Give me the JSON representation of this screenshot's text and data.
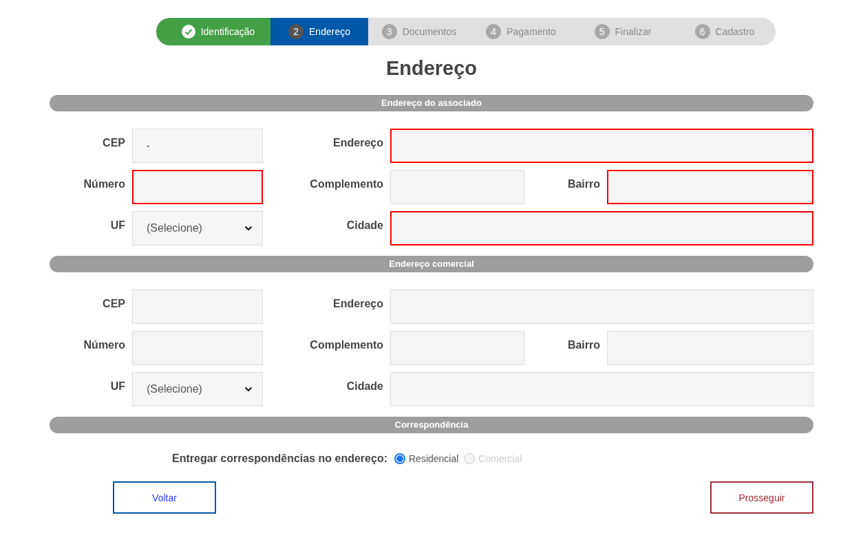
{
  "steps": [
    {
      "label": "Identificação",
      "done": true,
      "selected": false
    },
    {
      "number": "2",
      "label": "Endereço",
      "done": false,
      "selected": true
    },
    {
      "number": "3",
      "label": "Documentos",
      "done": false,
      "selected": false
    },
    {
      "number": "4",
      "label": "Pagamento",
      "done": false,
      "selected": false
    },
    {
      "number": "5",
      "label": "Finalizar",
      "done": false,
      "selected": false
    },
    {
      "number": "6",
      "label": "Cadastro",
      "done": false,
      "selected": false
    }
  ],
  "title": "Endereço",
  "sections": [
    {
      "title": "Endereço do associado",
      "rows": [
        [
          {
            "label": "CEP",
            "kind": "input",
            "value": "-",
            "invalid": false
          },
          {
            "label": "Endereço",
            "kind": "input",
            "invalid": true
          }
        ],
        [
          {
            "label": "Número",
            "kind": "input",
            "invalid": true
          },
          {
            "label": "Complemento",
            "kind": "input",
            "invalid": false
          },
          {
            "label": "Bairro",
            "kind": "input",
            "invalid": true
          }
        ],
        [
          {
            "label": "UF",
            "kind": "select",
            "value": "(Selecione)",
            "invalid": false
          },
          {
            "label": "Cidade",
            "kind": "input",
            "invalid": true
          }
        ]
      ]
    },
    {
      "title": "Endereço comercial",
      "rows": [
        [
          {
            "label": "CEP",
            "kind": "input",
            "invalid": false
          },
          {
            "label": "Endereço",
            "kind": "input",
            "invalid": false
          }
        ],
        [
          {
            "label": "Número",
            "kind": "input",
            "invalid": false
          },
          {
            "label": "Complemento",
            "kind": "input",
            "invalid": false
          },
          {
            "label": "Bairro",
            "kind": "input",
            "invalid": false
          }
        ],
        [
          {
            "label": "UF",
            "kind": "select",
            "value": "(Selecione)",
            "invalid": false
          },
          {
            "label": "Cidade",
            "kind": "input",
            "invalid": false
          }
        ]
      ]
    }
  ],
  "correspondence": {
    "title": "Correspondência",
    "question": "Entregar correspondências no endereço:",
    "options": [
      {
        "label": "Residencial",
        "selected": true,
        "disabled": false
      },
      {
        "label": "Comercial",
        "selected": false,
        "disabled": true
      }
    ]
  },
  "buttons": [
    {
      "label": "Voltar",
      "kind": "back"
    },
    {
      "label": "Prosseguir",
      "kind": "next"
    }
  ]
}
